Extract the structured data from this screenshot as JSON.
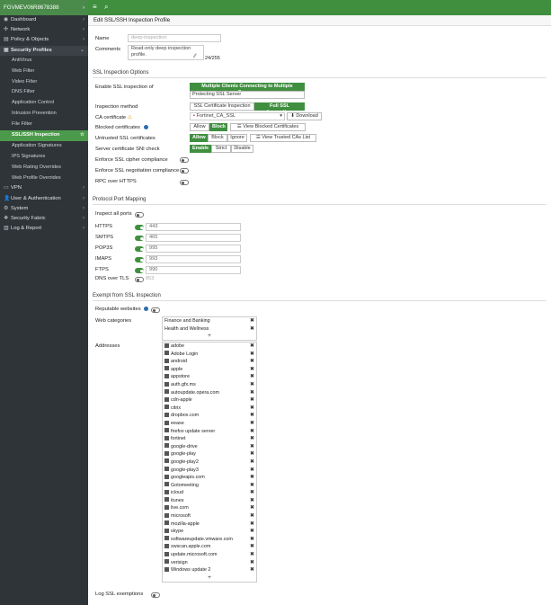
{
  "sidebar": {
    "device": "FGVMEV06R8678388",
    "items": [
      {
        "label": "Dashboard",
        "icon": "dashboard-icon",
        "glyph": "◉"
      },
      {
        "label": "Network",
        "icon": "network-icon",
        "glyph": "✣"
      },
      {
        "label": "Policy & Objects",
        "icon": "policy-icon",
        "glyph": "▤"
      }
    ],
    "open_section": {
      "label": "Security Profiles",
      "icon": "lock-icon",
      "glyph": "🔒"
    },
    "sub_items": [
      "AntiVirus",
      "Web Filter",
      "Video Filter",
      "DNS Filter",
      "Application Control",
      "Intrusion Prevention",
      "File Filter",
      "SSL/SSH Inspection",
      "Application Signatures",
      "IPS Signatures",
      "Web Rating Overrides",
      "Web Profile Overrides"
    ],
    "active_sub": "SSL/SSH Inspection",
    "bottom_items": [
      {
        "label": "VPN",
        "icon": "vpn-icon",
        "glyph": "▭"
      },
      {
        "label": "User & Authentication",
        "icon": "user-icon",
        "glyph": "👤"
      },
      {
        "label": "System",
        "icon": "gear-icon",
        "glyph": "⚙"
      },
      {
        "label": "Security Fabric",
        "icon": "fabric-icon",
        "glyph": "❖"
      },
      {
        "label": "Log & Report",
        "icon": "log-icon",
        "glyph": "▥"
      }
    ]
  },
  "topbar": {
    "menu_icon": "≡",
    "search_icon": "⌕"
  },
  "breadcrumb": "Edit SSL/SSH Inspection Profile",
  "form": {
    "name_label": "Name",
    "name_value": "deep-inspection",
    "comments_label": "Comments",
    "comments_value": "Read-only deep inspection profile.",
    "comments_count": "24/255"
  },
  "ssl_options": {
    "title": "SSL Inspection Options",
    "enable_label": "Enable SSL inspection of",
    "enable_opt1": "Multiple Clients Connecting to Multiple Servers",
    "enable_opt2": "Protecting SSL Server",
    "method_label": "Inspection method",
    "method_opt1": "SSL Certificate Inspection",
    "method_opt2": "Full SSL Inspection",
    "ca_label": "CA certificate",
    "ca_value": "Fortinet_CA_SSL",
    "download_label": "Download",
    "blocked_label": "Blocked certificates",
    "allow": "Allow",
    "block": "Block",
    "view_blocked": "View Blocked Certificates",
    "untrusted_label": "Untrusted SSL certificates",
    "ignore": "Ignore",
    "view_trusted": "View Trusted CAs List",
    "sni_label": "Server certificate SNI check",
    "enable": "Enable",
    "strict": "Strict",
    "disable": "Disable",
    "cipher_label": "Enforce SSL cipher compliance",
    "negotiation_label": "Enforce SSL negotiation compliance",
    "rpc_label": "RPC over HTTPS"
  },
  "ports": {
    "title": "Protocol Port Mapping",
    "inspect_all_label": "Inspect all ports",
    "rows": [
      {
        "label": "HTTPS",
        "value": "443"
      },
      {
        "label": "SMTPS",
        "value": "465"
      },
      {
        "label": "POP3S",
        "value": "995"
      },
      {
        "label": "IMAPS",
        "value": "993"
      },
      {
        "label": "FTPS",
        "value": "990"
      }
    ],
    "dns_label": "DNS over TLS",
    "dns_value": "853"
  },
  "exempt": {
    "title": "Exempt from SSL Inspection",
    "reputable_label": "Reputable websites",
    "web_categories_label": "Web categories",
    "categories": [
      "Finance and Banking",
      "Health and Wellness"
    ],
    "addresses_label": "Addresses",
    "addresses": [
      "adobe",
      "Adobe Login",
      "android",
      "apple",
      "appstore",
      "auth.gfx.ms",
      "autoupdate.opera.com",
      "cdn-apple",
      "citrix",
      "dropbox.com",
      "eease",
      "firefox update server",
      "fortinet",
      "google-drive",
      "google-play",
      "google-play2",
      "google-play3",
      "googleapis.com",
      "Gotomeeting",
      "icloud",
      "itunes",
      "live.com",
      "microsoft",
      "mozilla-apple",
      "skype",
      "softwareupdate.vmware.com",
      "swscan.apple.com",
      "update.microsoft.com",
      "verisign",
      "Windows update 2"
    ],
    "log_label": "Log SSL exemptions"
  },
  "colors": {
    "accent": "#3f8f3f",
    "sidebar": "#2f3438",
    "active": "#4b9a4b"
  }
}
